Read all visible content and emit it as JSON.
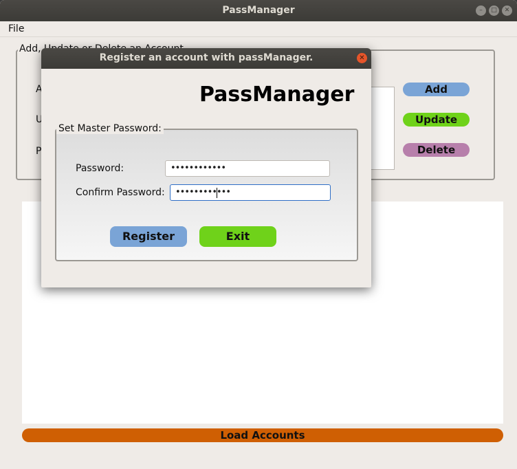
{
  "main_window": {
    "title": "PassManager",
    "menu": {
      "file_label": "File"
    },
    "group_title": "Add, Update or Delete an Account",
    "label_fragments": [
      "A",
      "U",
      "P"
    ],
    "buttons": {
      "add_label": "Add",
      "update_label": "Update",
      "delete_label": "Delete",
      "load_label": "Load Accounts"
    },
    "colors": {
      "add": "#7aa4d6",
      "update": "#6fd21a",
      "delete": "#b77fab",
      "load": "#cf5f03"
    }
  },
  "dialog": {
    "title": "Register an account with passManager.",
    "heading": "PassManager",
    "group_title": "Set Master Password:",
    "password_label": "Password:",
    "password_value": "••••••••••••",
    "confirm_label": "Confirm Password:",
    "confirm_value": "••••••••••••",
    "register_label": "Register",
    "exit_label": "Exit",
    "colors": {
      "register": "#7aa4d6",
      "exit": "#6fd21a",
      "close": "#e6552a"
    }
  }
}
